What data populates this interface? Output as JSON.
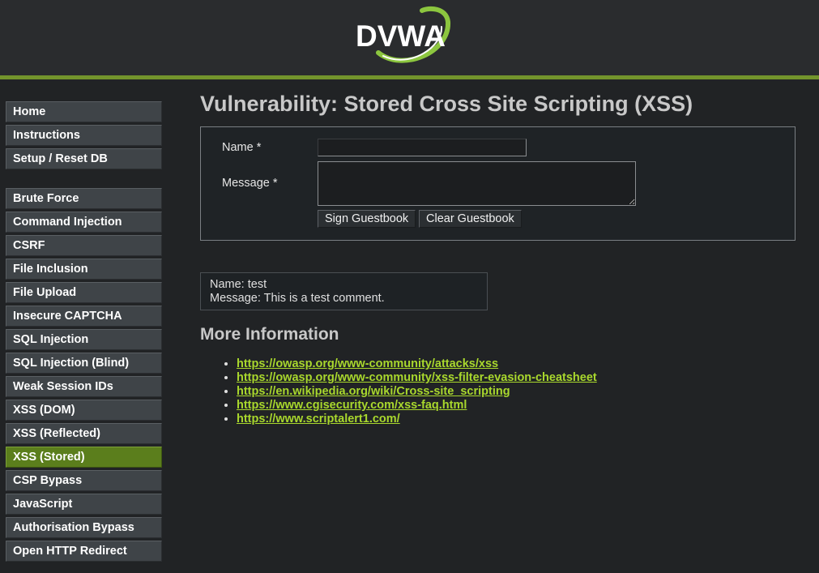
{
  "header": {
    "logo_text": "DVWA",
    "accent_color": "#73942c"
  },
  "sidebar": {
    "groups": [
      {
        "items": [
          "Home",
          "Instructions",
          "Setup / Reset DB"
        ]
      },
      {
        "items": [
          "Brute Force",
          "Command Injection",
          "CSRF",
          "File Inclusion",
          "File Upload",
          "Insecure CAPTCHA",
          "SQL Injection",
          "SQL Injection (Blind)",
          "Weak Session IDs",
          "XSS (DOM)",
          "XSS (Reflected)",
          "XSS (Stored)",
          "CSP Bypass",
          "JavaScript",
          "Authorisation Bypass",
          "Open HTTP Redirect"
        ]
      }
    ],
    "active_item": "XSS (Stored)",
    "active_color": "#5b7e1c"
  },
  "main": {
    "title": "Vulnerability: Stored Cross Site Scripting (XSS)",
    "form": {
      "name_label": "Name *",
      "name_value": "",
      "message_label": "Message *",
      "message_value": "",
      "sign_button": "Sign Guestbook",
      "clear_button": "Clear Guestbook"
    },
    "comment": {
      "name_line": "Name: test",
      "message_line": "Message: This is a test comment."
    },
    "more_info": {
      "title": "More Information",
      "links": [
        "https://owasp.org/www-community/attacks/xss",
        "https://owasp.org/www-community/xss-filter-evasion-cheatsheet",
        "https://en.wikipedia.org/wiki/Cross-site_scripting",
        "https://www.cgisecurity.com/xss-faq.html",
        "https://www.scriptalert1.com/"
      ],
      "link_color": "#a9d82d"
    }
  }
}
